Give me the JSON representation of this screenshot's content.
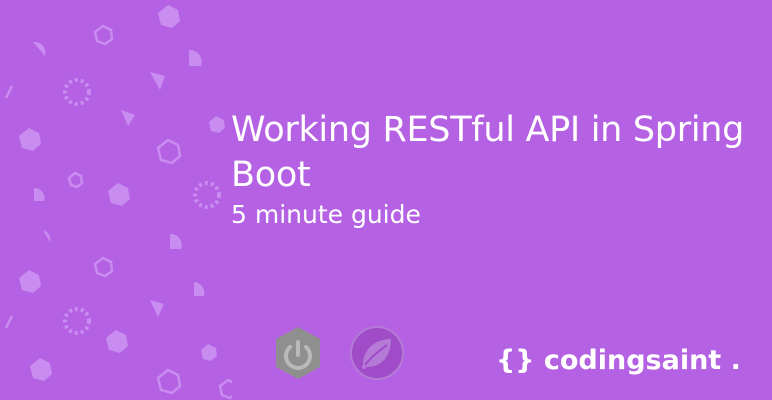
{
  "banner": {
    "title": "Working RESTful API in Spring Boot",
    "subtitle": "5 minute guide",
    "brand": "{} codingsaint ."
  },
  "colors": {
    "background": "#b561e3",
    "pattern": "#c98cf0",
    "text": "#ffffff",
    "spring_boot_logo": "#8f8f8f",
    "spring_logo": "#a04bc8"
  },
  "icons": [
    "spring-boot-logo-icon",
    "spring-leaf-logo-icon"
  ]
}
